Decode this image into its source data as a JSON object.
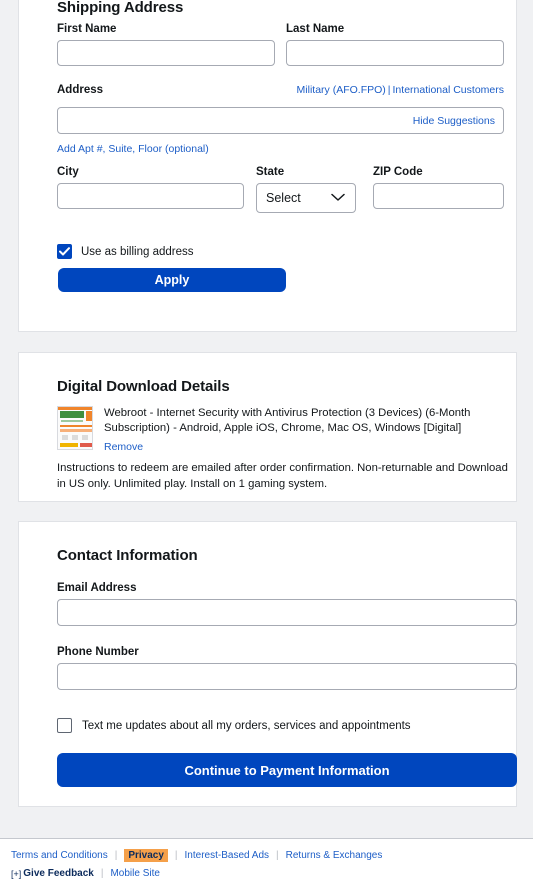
{
  "shipping": {
    "title": "Shipping Address",
    "first_name_label": "First Name",
    "first_name_value": "",
    "last_name_label": "Last Name",
    "last_name_value": "",
    "address_label": "Address",
    "address_value": "",
    "military_link": "Military (AFO.FPO)",
    "link_separator": "|",
    "international_link": "International Customers",
    "hide_suggestions": "Hide Suggestions",
    "apt_link": "Add Apt #, Suite, Floor (optional)",
    "city_label": "City",
    "city_value": "",
    "state_label": "State",
    "state_selected": "Select",
    "state_chevron": "chevron-down-icon",
    "zip_label": "ZIP Code",
    "zip_value": "",
    "billing_checkbox_label": "Use as billing address",
    "billing_checked": true,
    "apply_label": "Apply"
  },
  "digital": {
    "title": "Digital Download Details",
    "product_name": "Webroot - Internet Security with Antivirus Protection (3 Devices) (6-Month Subscription) - Android, Apple iOS, Chrome, Mac OS, Windows [Digital]",
    "remove_label": "Remove",
    "note": "Instructions to redeem are emailed after order confirmation. Non-returnable and Download in US only. Unlimited play. Install on 1 gaming system."
  },
  "contact": {
    "title": "Contact Information",
    "email_label": "Email Address",
    "email_value": "",
    "phone_label": "Phone Number",
    "phone_value": "",
    "sms_checkbox_label": "Text me updates about all my orders, services and appointments",
    "sms_checked": false,
    "continue_label": "Continue to Payment Information"
  },
  "footer": {
    "terms": "Terms and Conditions",
    "privacy": "Privacy",
    "interest_ads": "Interest-Based Ads",
    "returns": "Returns & Exchanges",
    "give_feedback": "Give Feedback",
    "mobile_site": "Mobile Site",
    "separator": "|"
  },
  "colors": {
    "brand_blue": "#0046be",
    "link_blue": "#1d5ec7",
    "highlight_orange": "#f5a04a",
    "page_bg": "#f0f1f3"
  }
}
